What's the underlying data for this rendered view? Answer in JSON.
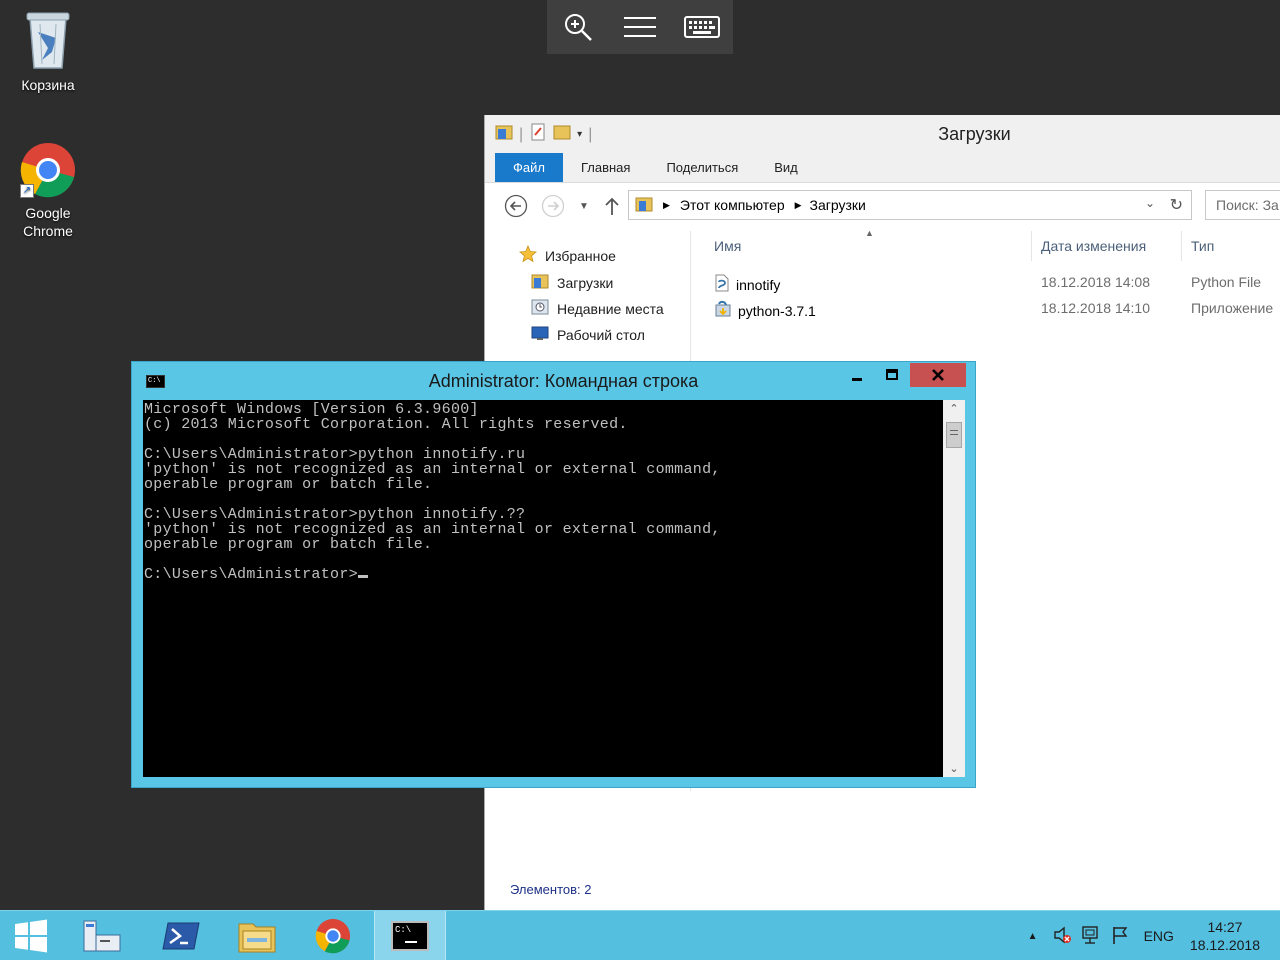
{
  "desktop": {
    "recycle_bin_label": "Корзина",
    "chrome_label_line1": "Google",
    "chrome_label_line2": "Chrome"
  },
  "remote_toolbar": {
    "icons": [
      "zoom-in-icon",
      "menu-icon",
      "keyboard-icon"
    ]
  },
  "explorer": {
    "title": "Загрузки",
    "ribbon_tabs": [
      "Файл",
      "Главная",
      "Поделиться",
      "Вид"
    ],
    "address": {
      "crumbs": [
        "Этот компьютер",
        "Загрузки"
      ]
    },
    "search_placeholder": "Поиск: За",
    "nav": {
      "favorites": "Избранное",
      "items": [
        "Загрузки",
        "Недавние места",
        "Рабочий стол"
      ]
    },
    "columns": {
      "name": "Имя",
      "date": "Дата изменения",
      "type": "Тип"
    },
    "files": [
      {
        "name": "innotify",
        "date": "18.12.2018 14:08",
        "type": "Python File"
      },
      {
        "name": "python-3.7.1",
        "date": "18.12.2018 14:10",
        "type": "Приложение"
      }
    ],
    "status": "Элементов: 2"
  },
  "cmd": {
    "title": "Administrator: Командная строка",
    "lines": [
      "Microsoft Windows [Version 6.3.9600]",
      "(c) 2013 Microsoft Corporation. All rights reserved.",
      "",
      "C:\\Users\\Administrator>python innotify.ru",
      "'python' is not recognized as an internal or external command,",
      "operable program or batch file.",
      "",
      "C:\\Users\\Administrator>python innotify.??",
      "'python' is not recognized as an internal or external command,",
      "operable program or batch file.",
      ""
    ],
    "prompt": "C:\\Users\\Administrator>"
  },
  "taskbar": {
    "language": "ENG",
    "time": "14:27",
    "date": "18.12.2018",
    "accent": "#55bfe0"
  }
}
